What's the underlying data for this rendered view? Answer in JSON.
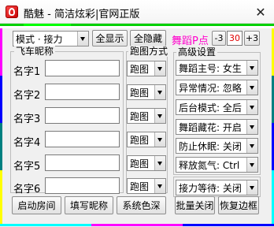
{
  "window": {
    "title": "酷魅 - 简洁炫彩|官网正版",
    "close_glyph": "✕"
  },
  "colors": {
    "accent_pink": "#ff00cc",
    "counter_red": "#e00000",
    "stripe_green": "#00d000",
    "stripe_magenta": "#ff00ff",
    "stripe_blue": "#0000ff",
    "stripe_yellow": "#ffff00",
    "stripe_cyan": "#00ffff",
    "stripe_teal": "#008080"
  },
  "toolbar": {
    "mode_select": "模式 · 接力",
    "show_all": "全显示",
    "hide_all": "全隐藏",
    "dance_p_label": "舞蹈P点",
    "dec_button": "-3",
    "counter_value": "30",
    "inc_button": "+3"
  },
  "racers": {
    "group_title": "飞车昵称",
    "items": [
      {
        "label": "名字1",
        "value": ""
      },
      {
        "label": "名字2",
        "value": ""
      },
      {
        "label": "名字3",
        "value": ""
      },
      {
        "label": "名字4",
        "value": ""
      },
      {
        "label": "名字5",
        "value": ""
      },
      {
        "label": "名字6",
        "value": ""
      }
    ]
  },
  "run_mode": {
    "group_title": "跑图方式",
    "options": [
      "跑图",
      "跑图",
      "跑图",
      "跑图",
      "跑图",
      "跑图"
    ]
  },
  "advanced": {
    "group_title": "高级设置",
    "settings": [
      {
        "value": "舞蹈主号: 女生"
      },
      {
        "value": "异常情况: 忽略"
      },
      {
        "value": "后台模式: 全后"
      },
      {
        "value": "舞蹈藏花: 开启"
      },
      {
        "value": "防止休眠: 关闭"
      },
      {
        "value": "释放氮气: Ctrl"
      }
    ]
  },
  "relay_wait": {
    "value": "接力等待: 关闭"
  },
  "bottom": {
    "start_room": "启动房间",
    "fill_nick": "填写昵称",
    "system_dark": "系统色深",
    "batch_close": "批量关闭",
    "restore_border": "恢复边框"
  }
}
